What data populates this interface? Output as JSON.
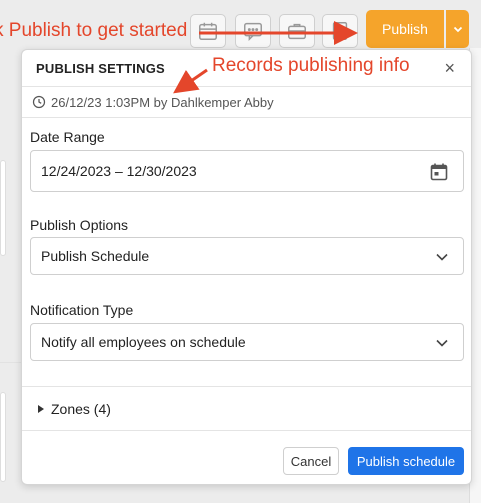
{
  "annotations": {
    "publish_hint": "k Publish to get started",
    "records_hint": "Records publishing info"
  },
  "toolbar": {
    "publish_label": "Publish",
    "buttons": [
      "calendar-icon",
      "chat-icon",
      "briefcase-icon",
      "page-icon"
    ]
  },
  "colors": {
    "publish_orange": "#f5a42b",
    "primary_blue": "#1f74e8",
    "annotation_red": "#e4462b"
  },
  "modal": {
    "title": "PUBLISH SETTINGS",
    "close_glyph": "×",
    "info": "26/12/23 1:03PM by Dahlkemper Abby",
    "date_range": {
      "label": "Date Range",
      "value": "12/24/2023 – 12/30/2023"
    },
    "publish_options": {
      "label": "Publish Options",
      "value": "Publish Schedule"
    },
    "notification_type": {
      "label": "Notification Type",
      "value": "Notify all employees on schedule"
    },
    "zones_label": "Zones (4)",
    "cancel_label": "Cancel",
    "submit_label": "Publish schedule"
  }
}
